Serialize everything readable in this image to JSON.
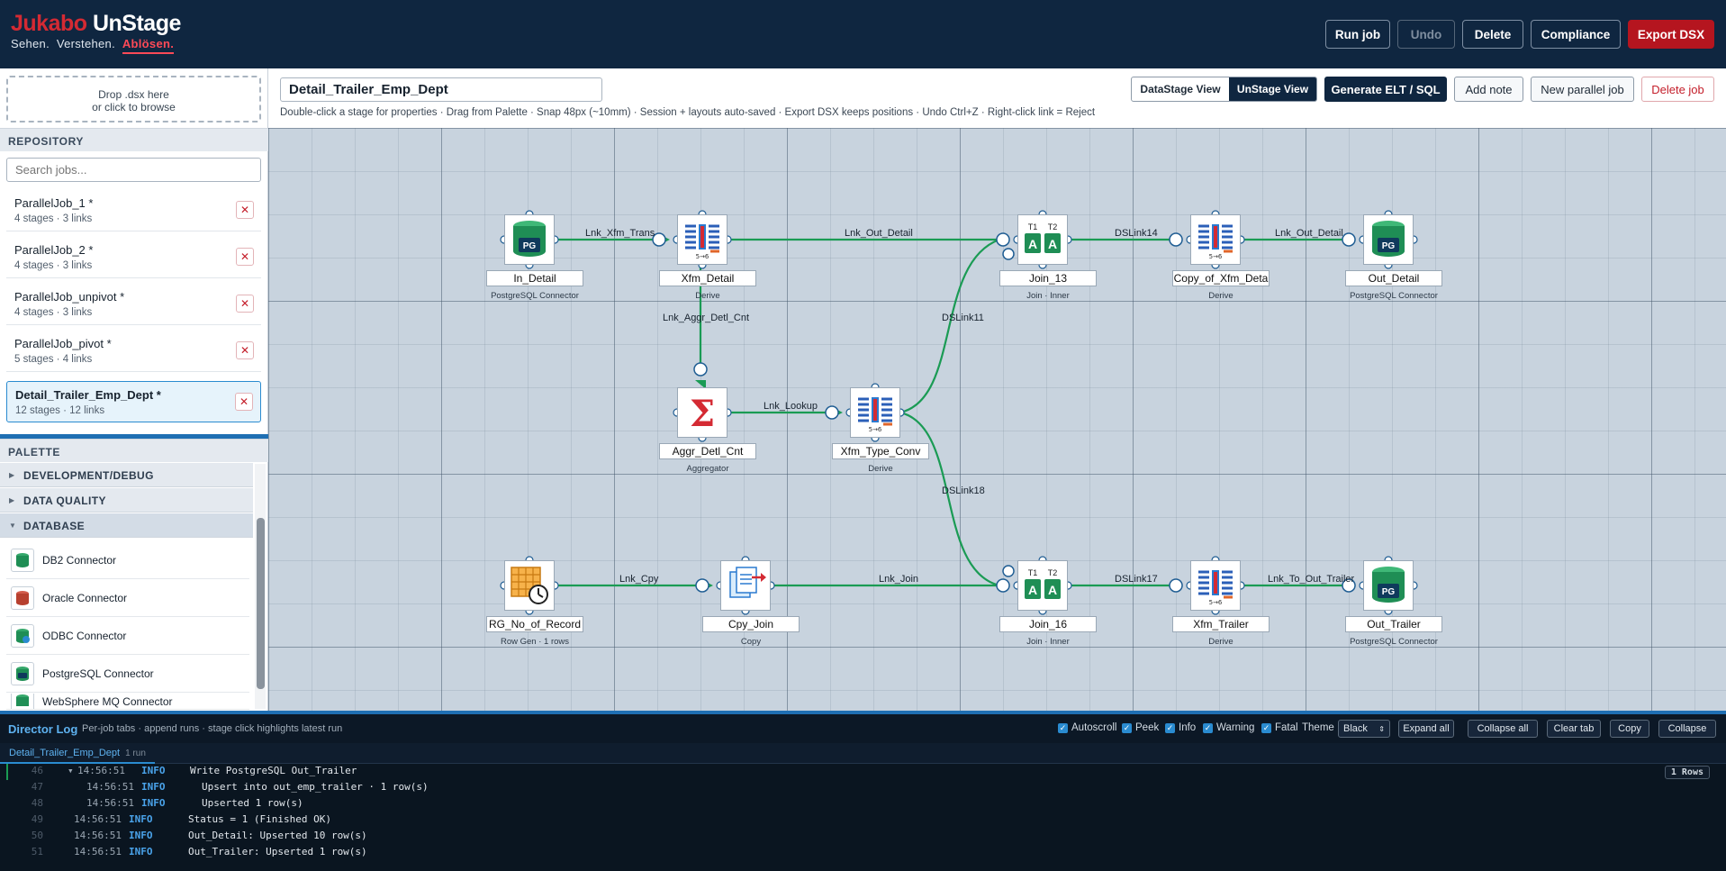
{
  "header": {
    "brand_red": "Jukabo",
    "brand_white": "UnStage",
    "tagline_a": "Sehen.",
    "tagline_b": "Verstehen.",
    "tagline_c": "Ablösen.",
    "buttons": {
      "run": "Run job",
      "undo": "Undo",
      "delete": "Delete",
      "compliance": "Compliance",
      "export": "Export DSX"
    }
  },
  "left": {
    "dropzone_line1": "Drop .dsx here",
    "dropzone_line2": "or click to browse",
    "repository_title": "REPOSITORY",
    "search_placeholder": "Search jobs...",
    "jobs": [
      {
        "name": "ParallelJob_1 *",
        "stats": "4 stages · 3 links"
      },
      {
        "name": "ParallelJob_2 *",
        "stats": "4 stages · 3 links"
      },
      {
        "name": "ParallelJob_unpivot *",
        "stats": "4 stages · 3 links"
      },
      {
        "name": "ParallelJob_pivot *",
        "stats": "5 stages · 4 links"
      },
      {
        "name": "Detail_Trailer_Emp_Dept *",
        "stats": "12 stages · 12 links"
      }
    ],
    "delete_glyph": "✕",
    "palette_title": "PALETTE",
    "categories": [
      "DEVELOPMENT/DEBUG",
      "DATA QUALITY",
      "DATABASE"
    ],
    "palette_items": [
      "DB2 Connector",
      "Oracle Connector",
      "ODBC Connector",
      "PostgreSQL Connector",
      "WebSphere MQ Connector"
    ]
  },
  "toolbar": {
    "job_name": "Detail_Trailer_Emp_Dept",
    "hint": "Double-click a stage for properties · Drag from Palette · Snap 48px (~10mm) · Session + layouts auto-saved · Export DSX keeps positions · Undo Ctrl+Z · Right-click link = Reject",
    "view_datastage": "DataStage View",
    "view_unstage": "UnStage View",
    "generate": "Generate ELT / SQL",
    "add_note": "Add note",
    "new_parallel": "New parallel job",
    "delete_job": "Delete job"
  },
  "canvas": {
    "stages": [
      {
        "name": "In_Detail",
        "type": "PostgreSQL Connector",
        "icon": "postgres-icon"
      },
      {
        "name": "Xfm_Detail",
        "type": "Derive",
        "icon": "transformer-icon"
      },
      {
        "name": "Join_13",
        "type": "Join · Inner",
        "icon": "join-icon"
      },
      {
        "name": "Copy_of_Xfm_Deta",
        "type": "Derive",
        "icon": "transformer-icon"
      },
      {
        "name": "Out_Detail",
        "type": "PostgreSQL Connector",
        "icon": "postgres-icon"
      },
      {
        "name": "Aggr_Detl_Cnt",
        "type": "Aggregator",
        "icon": "sigma-icon"
      },
      {
        "name": "Xfm_Type_Conv",
        "type": "Derive",
        "icon": "transformer-icon"
      },
      {
        "name": "RG_No_of_Record",
        "type": "Row Gen · 1 rows",
        "icon": "rowgen-icon"
      },
      {
        "name": "Cpy_Join",
        "type": "Copy",
        "icon": "copy-icon"
      },
      {
        "name": "Join_16",
        "type": "Join · Inner",
        "icon": "join-icon"
      },
      {
        "name": "Xfm_Trailer",
        "type": "Derive",
        "icon": "transformer-icon"
      },
      {
        "name": "Out_Trailer",
        "type": "PostgreSQL Connector",
        "icon": "postgres-icon"
      }
    ],
    "links": [
      "Lnk_Xfm_Trans",
      "Lnk_Out_Detail",
      "DSLink14",
      "Lnk_Out_Detail",
      "Lnk_Aggr_Detl_Cnt",
      "Lnk_Lookup",
      "DSLink11",
      "DSLink18",
      "Lnk_Cpy",
      "Lnk_Join",
      "DSLink17",
      "Lnk_To_Out_Trailer"
    ],
    "pg_label": "PG",
    "xfm_label": "5→6",
    "join_t1": "T1",
    "join_t2": "T2",
    "join_a": "A",
    "sigma": "Σ",
    "link_color": "#1a9b54"
  },
  "log": {
    "title": "Director Log",
    "subtitle": "Per-job tabs · append runs · stage click highlights latest run",
    "checks": [
      "Autoscroll",
      "Peek",
      "Info",
      "Warning",
      "Fatal"
    ],
    "theme_label": "Theme",
    "theme_value": "Black",
    "buttons": [
      "Expand all",
      "Collapse all",
      "Clear tab",
      "Copy",
      "Collapse"
    ],
    "tab_name": "Detail_Trailer_Emp_Dept",
    "tab_count": "1 run",
    "rows_badge": "1 Rows",
    "lines": [
      {
        "no": "46",
        "ts": "14:56:51",
        "lv": "INFO",
        "msg": "Write PostgreSQL Out_Trailer"
      },
      {
        "no": "47",
        "ts": "14:56:51",
        "lv": "INFO",
        "msg": "Upsert into out_emp_trailer · 1 row(s)"
      },
      {
        "no": "48",
        "ts": "14:56:51",
        "lv": "INFO",
        "msg": "Upserted 1 row(s)"
      },
      {
        "no": "49",
        "ts": "14:56:51",
        "lv": "INFO",
        "msg": "Status = 1 (Finished OK)"
      },
      {
        "no": "50",
        "ts": "14:56:51",
        "lv": "INFO",
        "msg": "Out_Detail: Upserted 10 row(s)"
      },
      {
        "no": "51",
        "ts": "14:56:51",
        "lv": "INFO",
        "msg": "Out_Trailer: Upserted 1 row(s)"
      }
    ]
  }
}
